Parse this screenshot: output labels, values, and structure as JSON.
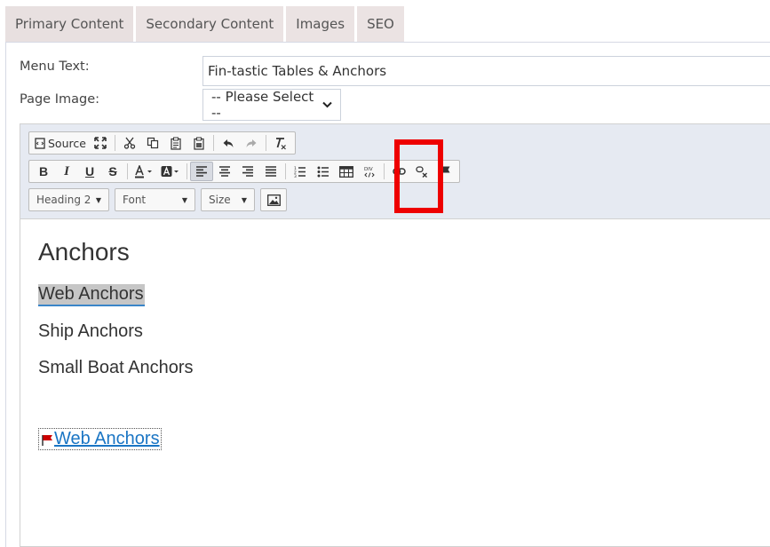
{
  "tabs": [
    {
      "label": "Primary Content"
    },
    {
      "label": "Secondary Content"
    },
    {
      "label": "Images"
    },
    {
      "label": "SEO"
    }
  ],
  "form": {
    "menu_text_label": "Menu Text:",
    "menu_text_value": "Fin-tastic Tables & Anchors",
    "page_image_label": "Page Image:",
    "page_image_selected": "-- Please Select --"
  },
  "toolbar": {
    "source_label": "Source",
    "format_combo": "Heading 2",
    "font_combo": "Font",
    "size_combo": "Size",
    "highlight_color": "#ee0000"
  },
  "content": {
    "heading": "Anchors",
    "paragraphs": [
      "Web Anchors",
      "Ship Anchors",
      "Small Boat Anchors"
    ],
    "anchor_link": "Web Anchors"
  }
}
